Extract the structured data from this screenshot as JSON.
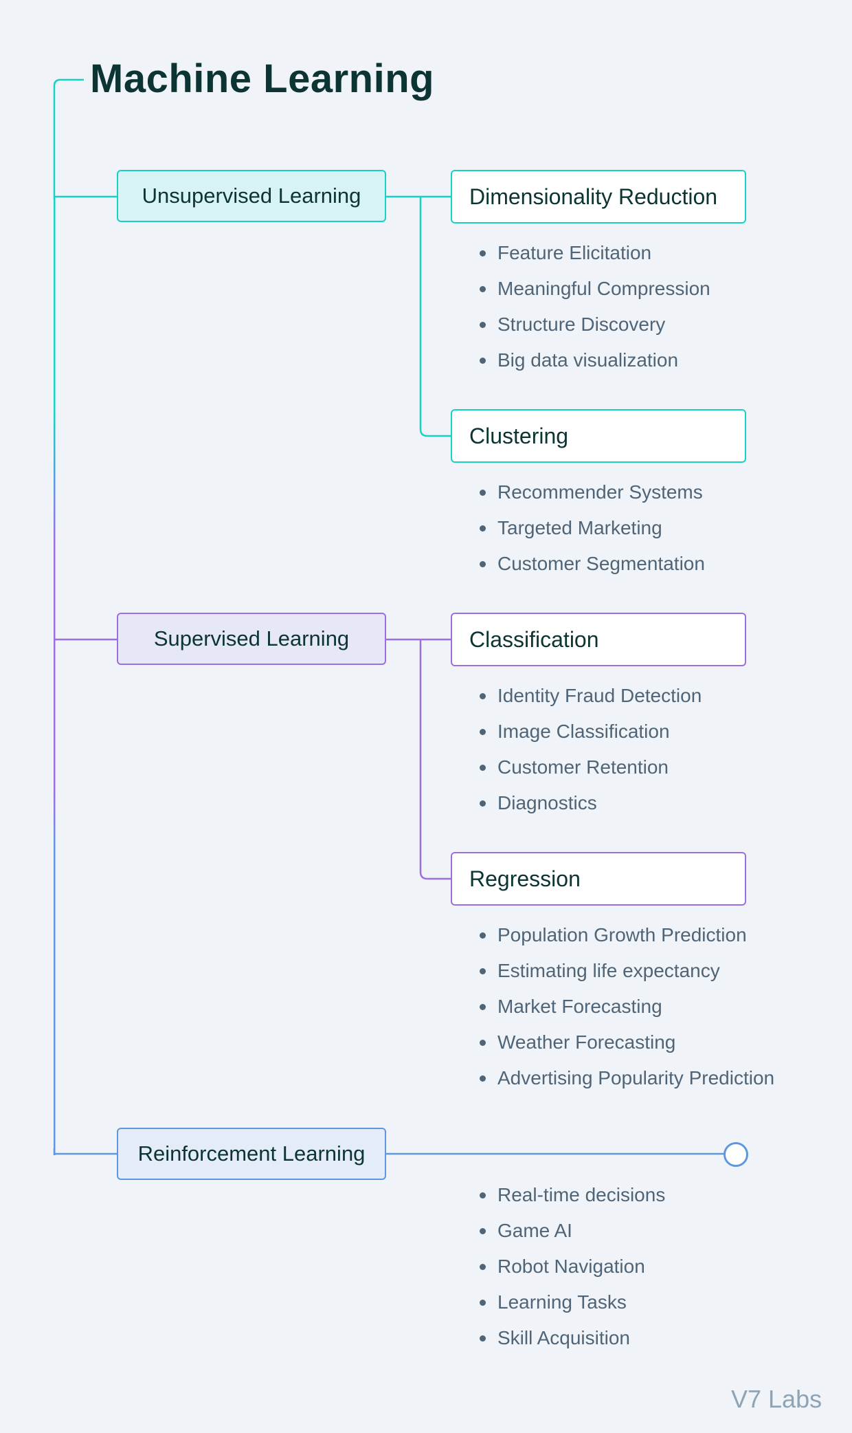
{
  "title": "Machine Learning",
  "branches": [
    {
      "label": "Unsupervised Learning",
      "color": "#17d1c6",
      "children": [
        {
          "label": "Dimensionality Reduction",
          "items": [
            "Feature Elicitation",
            "Meaningful Compression",
            "Structure Discovery",
            "Big data visualization"
          ]
        },
        {
          "label": "Clustering",
          "items": [
            "Recommender Systems",
            "Targeted Marketing",
            "Customer Segmentation"
          ]
        }
      ]
    },
    {
      "label": "Supervised Learning",
      "color": "#9c6fe0",
      "children": [
        {
          "label": "Classification",
          "items": [
            "Identity Fraud Detection",
            "Image Classification",
            "Customer Retention",
            "Diagnostics"
          ]
        },
        {
          "label": "Regression",
          "items": [
            "Population Growth Prediction",
            "Estimating life expectancy",
            "Market Forecasting",
            "Weather Forecasting",
            "Advertising Popularity Prediction"
          ]
        }
      ]
    },
    {
      "label": "Reinforcement Learning",
      "color": "#5f97df",
      "items": [
        "Real-time decisions",
        "Game AI",
        "Robot Navigation",
        "Learning Tasks",
        "Skill Acquisition"
      ]
    }
  ],
  "footer": "V7 Labs"
}
